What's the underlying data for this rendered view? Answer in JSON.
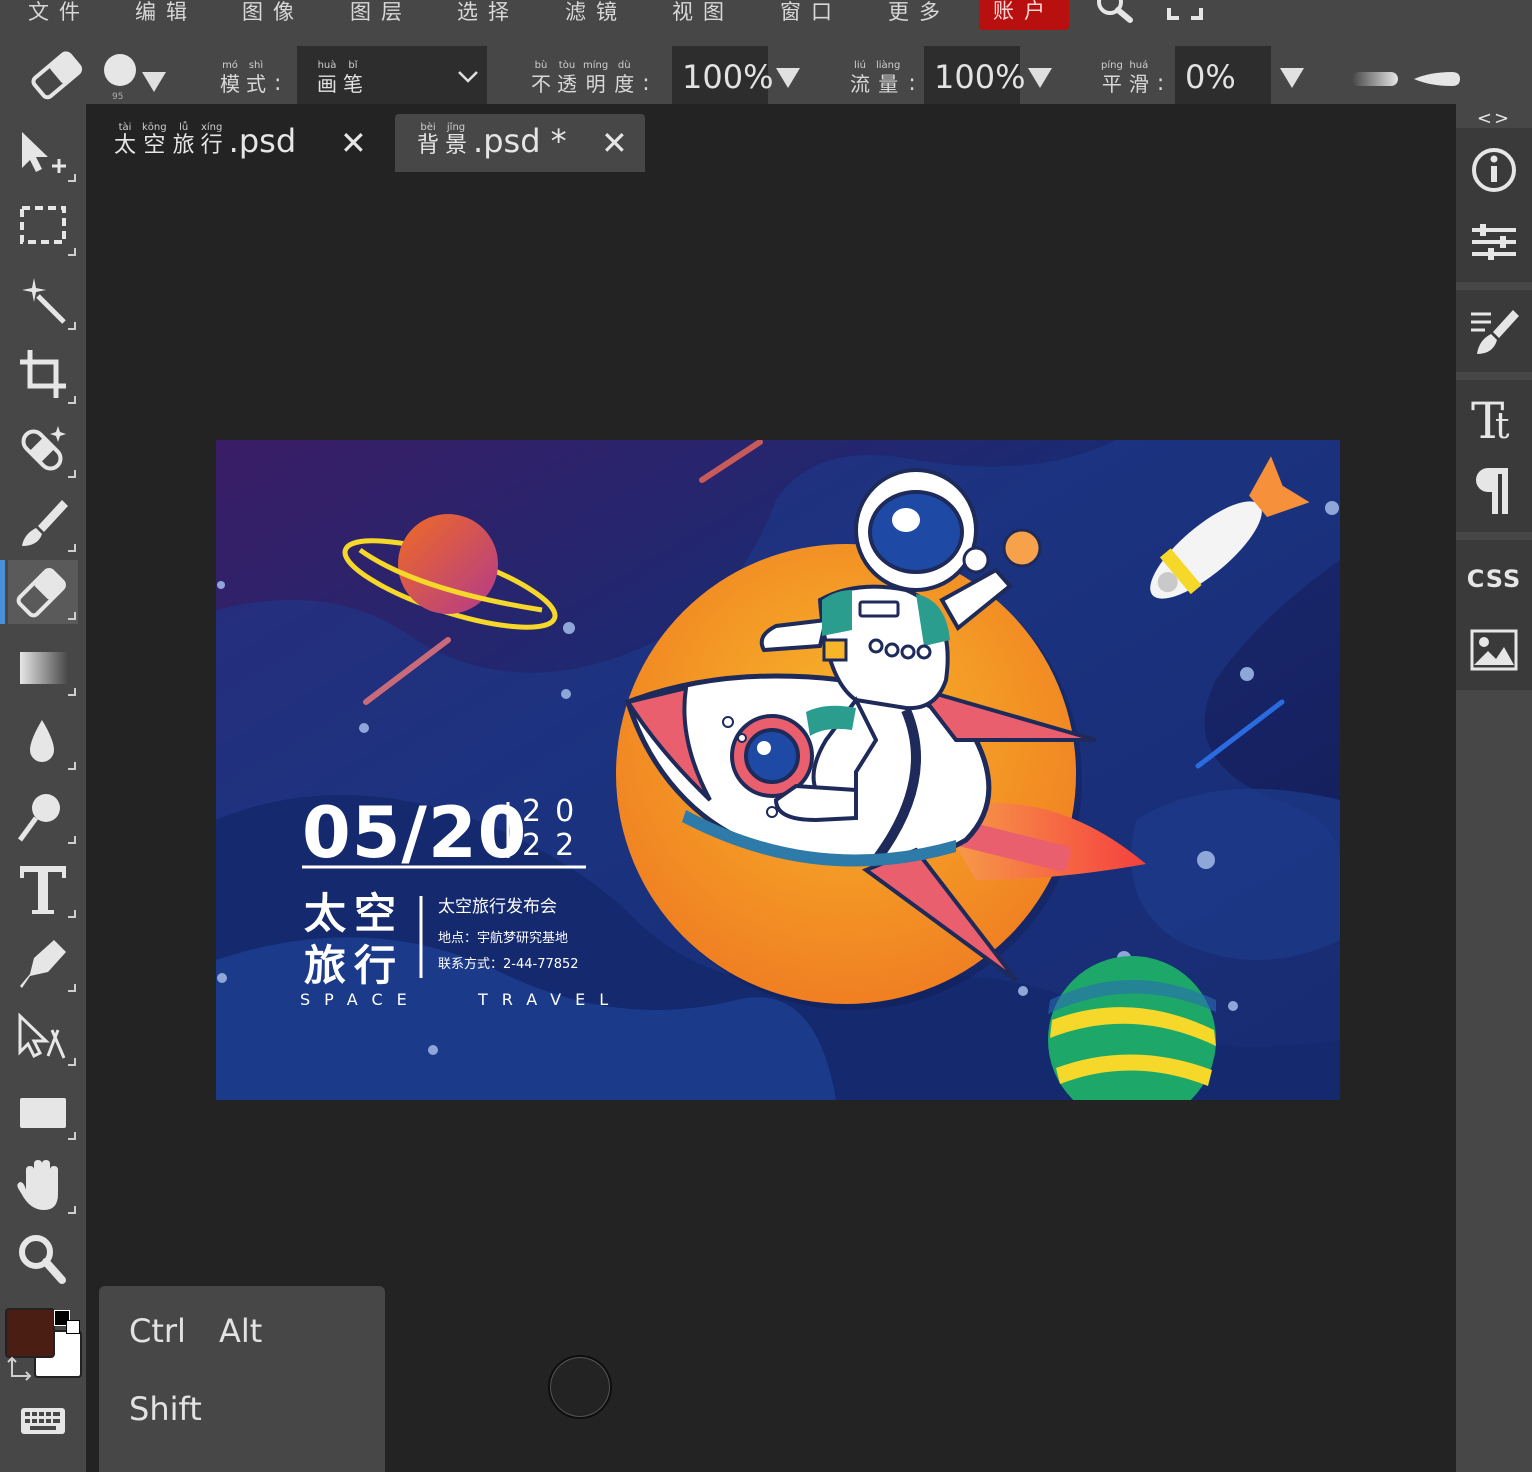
{
  "menu": {
    "items": [
      "文件",
      "编辑",
      "图像",
      "图层",
      "选择",
      "滤镜",
      "视图",
      "窗口",
      "更多"
    ],
    "account": "账户"
  },
  "options": {
    "brush_size": "95",
    "mode": {
      "chars": [
        {
          "py": "mó",
          "hz": "模"
        },
        {
          "py": "shì",
          "hz": "式"
        }
      ],
      "value": [
        {
          "py": "huà",
          "hz": "画"
        },
        {
          "py": "bǐ",
          "hz": "笔"
        }
      ]
    },
    "opacity": {
      "chars": [
        {
          "py": "bù",
          "hz": "不"
        },
        {
          "py": "tòu",
          "hz": "透"
        },
        {
          "py": "míng",
          "hz": "明"
        },
        {
          "py": "dù",
          "hz": "度"
        }
      ],
      "value": "100%"
    },
    "flow": {
      "chars": [
        {
          "py": "liú",
          "hz": "流"
        },
        {
          "py": "liàng",
          "hz": "量"
        }
      ],
      "value": "100%"
    },
    "smooth": {
      "chars": [
        {
          "py": "píng",
          "hz": "平"
        },
        {
          "py": "huá",
          "hz": "滑"
        }
      ],
      "value": "0%"
    }
  },
  "tabs": [
    {
      "chars": [
        {
          "py": "tài",
          "hz": "太"
        },
        {
          "py": "kōng",
          "hz": "空"
        },
        {
          "py": "lǚ",
          "hz": "旅"
        },
        {
          "py": "xíng",
          "hz": "行"
        }
      ],
      "ext": ".psd",
      "active": false
    },
    {
      "chars": [
        {
          "py": "bèi",
          "hz": "背"
        },
        {
          "py": "jǐng",
          "hz": "景"
        }
      ],
      "ext": ".psd *",
      "active": true
    }
  ],
  "tab_close": "✕",
  "right_panel": {
    "toggle": "<>",
    "css_label": "CSS"
  },
  "poster": {
    "date": "05/20",
    "year_top": "20",
    "year_bottom": "22",
    "title_line1": "太空",
    "title_line2": "旅行",
    "event": "太空旅行发布会",
    "location": "地点：宇航梦研究基地",
    "contact": "联系方式：2-44-77852",
    "subtitle": "SPACE   TRAVEL"
  },
  "colors": {
    "foreground": "#4a1e12",
    "background": "#ffffff",
    "accent": "#4a90d9",
    "account_bg": "#b8100f"
  },
  "keys": {
    "ctrl": "Ctrl",
    "alt": "Alt",
    "shift": "Shift"
  },
  "icons": [
    "eraser-icon",
    "brush-preset-icon",
    "move-icon",
    "marquee-icon",
    "magic-wand-icon",
    "crop-icon",
    "healing-icon",
    "brush-icon",
    "eraser-icon",
    "gradient-icon",
    "blur-icon",
    "dodge-icon",
    "type-icon",
    "pen-icon",
    "path-select-icon",
    "rectangle-icon",
    "hand-icon",
    "zoom-icon",
    "keyboard-icon",
    "info-icon",
    "adjust-icon",
    "brush-settings-icon",
    "character-icon",
    "paragraph-icon",
    "image-icon",
    "search-icon",
    "fullscreen-icon"
  ]
}
